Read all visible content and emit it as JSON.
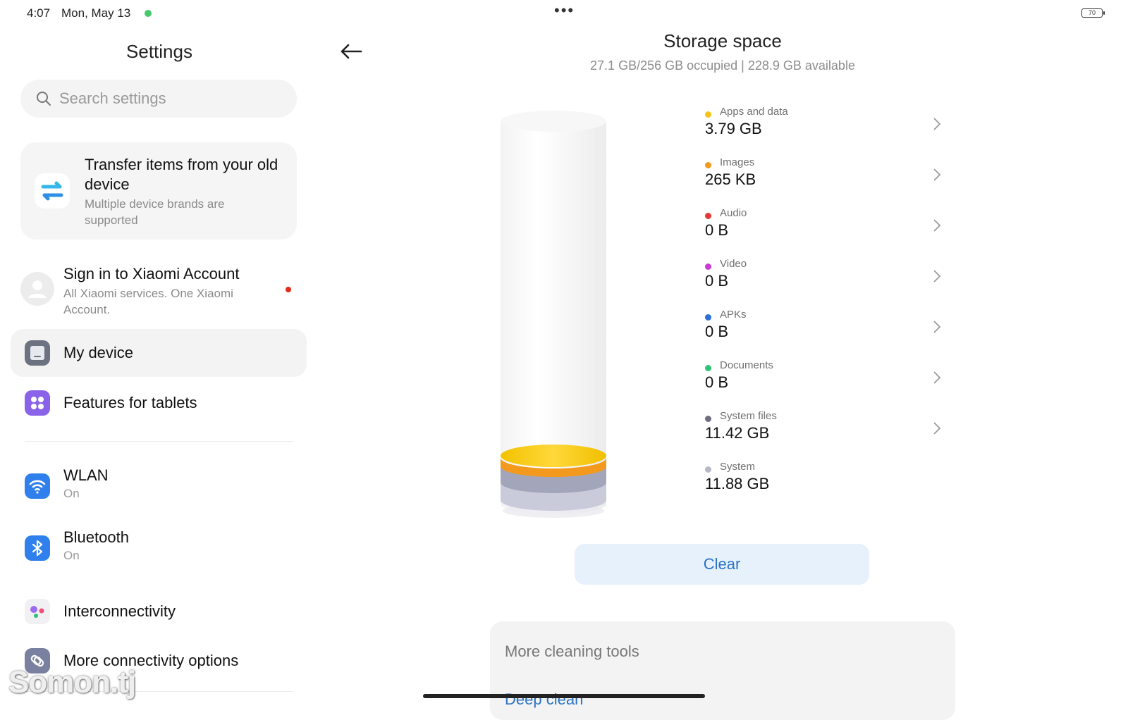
{
  "status_bar": {
    "time": "4:07",
    "date": "Mon, May 13",
    "battery": "70"
  },
  "left_panel": {
    "title": "Settings",
    "search_placeholder": "Search settings",
    "transfer_card": {
      "title": "Transfer items from your old device",
      "subtitle": "Multiple device brands are supported"
    },
    "account": {
      "title": "Sign in to Xiaomi Account",
      "subtitle": "All Xiaomi services. One Xiaomi Account."
    },
    "items": [
      {
        "label": "My device",
        "sub": "",
        "icon": "device-icon",
        "selected": true
      },
      {
        "label": "Features for tablets",
        "sub": "",
        "icon": "grid-icon"
      },
      {
        "label": "WLAN",
        "sub": "On",
        "icon": "wifi-icon"
      },
      {
        "label": "Bluetooth",
        "sub": "On",
        "icon": "bluetooth-icon"
      },
      {
        "label": "Interconnectivity",
        "sub": "",
        "icon": "interconnectivity-icon"
      },
      {
        "label": "More connectivity options",
        "sub": "",
        "icon": "link-icon"
      }
    ],
    "watermark": "Somon.tj"
  },
  "right_panel": {
    "title": "Storage space",
    "subtitle": "27.1 GB/256 GB occupied | 228.9 GB available",
    "categories": [
      {
        "name": "Apps and data",
        "size": "3.79 GB",
        "color": "#f5c518",
        "has_chevron": true
      },
      {
        "name": "Images",
        "size": "265 KB",
        "color": "#f39a1e",
        "has_chevron": true
      },
      {
        "name": "Audio",
        "size": "0 B",
        "color": "#e53935",
        "has_chevron": true
      },
      {
        "name": "Video",
        "size": "0 B",
        "color": "#c93ad8",
        "has_chevron": true
      },
      {
        "name": "APKs",
        "size": "0 B",
        "color": "#2c6fd6",
        "has_chevron": true
      },
      {
        "name": "Documents",
        "size": "0 B",
        "color": "#2ec47a",
        "has_chevron": true
      },
      {
        "name": "System files",
        "size": "11.42 GB",
        "color": "#6e6e80",
        "has_chevron": true
      },
      {
        "name": "System",
        "size": "11.88 GB",
        "color": "#b7b9c6",
        "has_chevron": false
      }
    ],
    "clear_label": "Clear",
    "tools_card": {
      "title": "More cleaning tools",
      "first_item": "Deep clean"
    }
  }
}
